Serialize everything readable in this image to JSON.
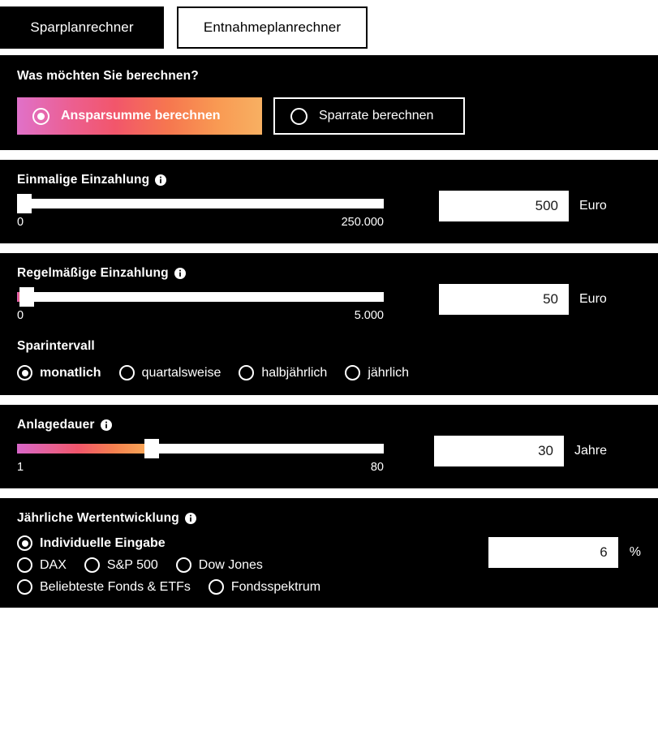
{
  "tabs": [
    {
      "label": "Sparplanrechner",
      "active": true
    },
    {
      "label": "Entnahmeplanrechner",
      "active": false
    }
  ],
  "calc_mode": {
    "title": "Was möchten Sie berechnen?",
    "options": [
      {
        "label": "Ansparsumme berechnen",
        "selected": true
      },
      {
        "label": "Sparrate berechnen",
        "selected": false
      }
    ],
    "gradient": {
      "from": "#e071c9",
      "mid": "#f2566b",
      "to": "#f8b062"
    }
  },
  "one_time": {
    "title": "Einmalige Einzahlung",
    "info_icon": "info-icon",
    "scale_min": "0",
    "scale_max": "250.000",
    "value": "500",
    "unit": "Euro",
    "fill_percent": 0.2,
    "thumb_percent": 2.0
  },
  "regular": {
    "title": "Regelmäßige Einzahlung",
    "info_icon": "info-icon",
    "scale_min": "0",
    "scale_max": "5.000",
    "value": "50",
    "unit": "Euro",
    "fill_percent": 1.0,
    "thumb_percent": 2.6,
    "interval": {
      "title": "Sparintervall",
      "options": [
        {
          "label": "monatlich",
          "selected": true
        },
        {
          "label": "quartalsweise",
          "selected": false
        },
        {
          "label": "halbjährlich",
          "selected": false
        },
        {
          "label": "jährlich",
          "selected": false
        }
      ]
    }
  },
  "duration": {
    "title": "Anlagedauer",
    "info_icon": "info-icon",
    "scale_min": "1",
    "scale_max": "80",
    "value": "30",
    "unit": "Jahre",
    "fill_percent": 36.7,
    "thumb_percent": 36.7
  },
  "performance": {
    "title": "Jährliche Wertentwicklung",
    "info_icon": "info-icon",
    "value": "6",
    "unit": "%",
    "options": [
      {
        "label": "Individuelle Eingabe",
        "selected": true
      },
      {
        "label": "DAX",
        "selected": false
      },
      {
        "label": "S&P 500",
        "selected": false
      },
      {
        "label": "Dow Jones",
        "selected": false
      },
      {
        "label": "Beliebteste Fonds & ETFs",
        "selected": false
      },
      {
        "label": "Fondsspektrum",
        "selected": false
      }
    ]
  }
}
